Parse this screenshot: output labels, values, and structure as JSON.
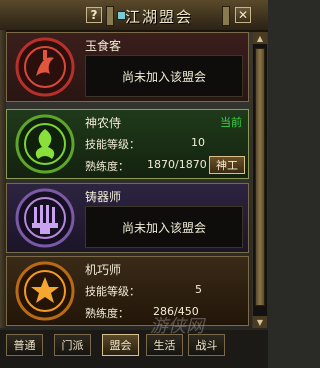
{
  "window": {
    "title": "江湖盟会",
    "help_label": "?",
    "close_label": "✕"
  },
  "guilds": [
    {
      "name": "玉食客",
      "status": "尚未加入该盟会",
      "emblem": "jade-food-emblem",
      "color": "#d9493a"
    },
    {
      "name": "神农侍",
      "current_badge": "当前",
      "skill_level_label": "技能等级：",
      "skill_level": "10",
      "proficiency_label": "熟练度：",
      "proficiency": "1870/1870",
      "action_label": "神工",
      "emblem": "shennong-emblem",
      "color": "#7ed234"
    },
    {
      "name": "铸器师",
      "status": "尚未加入该盟会",
      "emblem": "forge-emblem",
      "color": "#b48ad8"
    },
    {
      "name": "机巧师",
      "skill_level_label": "技能等级：",
      "skill_level": "5",
      "proficiency_label": "熟练度：",
      "proficiency": "286/450",
      "emblem": "mechanic-emblem",
      "color": "#f29a22"
    }
  ],
  "tabs": [
    "普通",
    "门派",
    "盟会",
    "生活",
    "战斗"
  ],
  "active_tab": "盟会",
  "watermark": "游侠网"
}
